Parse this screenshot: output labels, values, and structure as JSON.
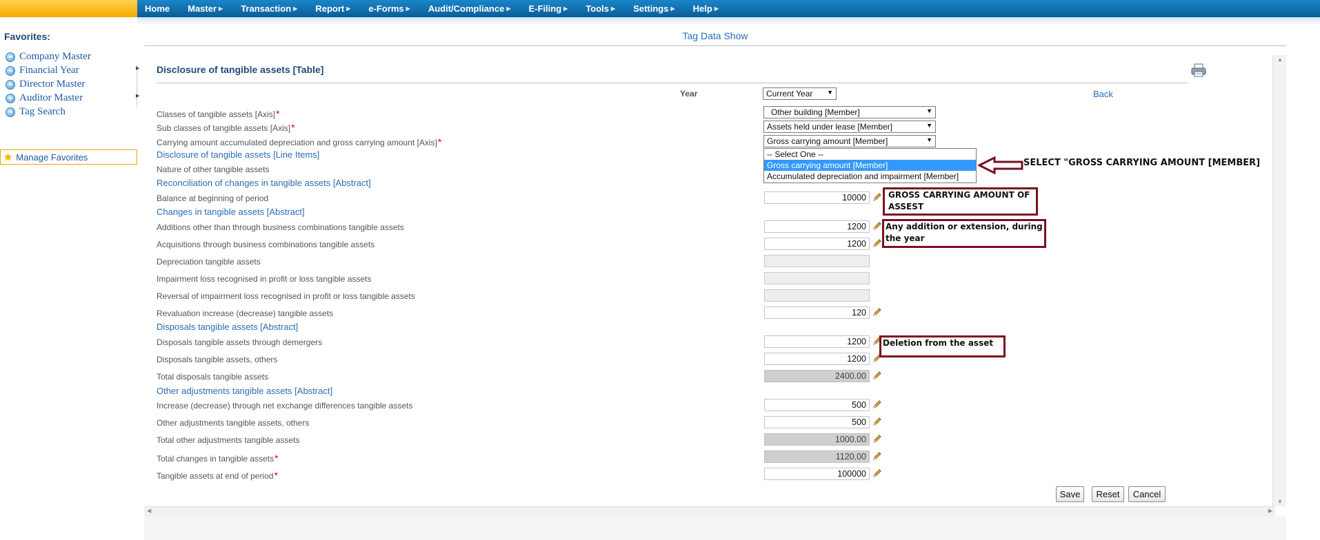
{
  "topmenu": [
    {
      "label": "Home",
      "has_sub": false
    },
    {
      "label": "Master",
      "has_sub": true
    },
    {
      "label": "Transaction",
      "has_sub": true
    },
    {
      "label": "Report",
      "has_sub": true
    },
    {
      "label": "e-Forms",
      "has_sub": true
    },
    {
      "label": "Audit/Compliance",
      "has_sub": true
    },
    {
      "label": "E-Filing",
      "has_sub": true
    },
    {
      "label": "Tools",
      "has_sub": true
    },
    {
      "label": "Settings",
      "has_sub": true
    },
    {
      "label": "Help",
      "has_sub": true
    }
  ],
  "sidebar": {
    "title": "Favorites:",
    "items": [
      "Company Master",
      "Financial Year",
      "Director Master",
      "Auditor Master",
      "Tag Search"
    ],
    "manage_label": "Manage Favorites"
  },
  "header": {
    "tag_data_show": "Tag Data Show"
  },
  "form": {
    "title": "Disclosure of tangible assets [Table]",
    "year_label": "Year",
    "year_value": "Current Year",
    "back_label": "Back",
    "axes": [
      {
        "label": "Classes of tangible assets [Axis]",
        "required": true,
        "value": "Other building [Member]"
      },
      {
        "label": "Sub classes of tangible assets [Axis]",
        "required": true,
        "value": "Assets held under lease [Member]"
      },
      {
        "label": "Carrying amount accumulated depreciation and gross carrying amount [Axis]",
        "required": true,
        "value": "Gross carrying amount [Member]"
      }
    ],
    "dropdown_options": [
      "-- Select One --",
      "Gross carrying amount [Member]",
      "Accumulated depreciation and impairment [Member]"
    ],
    "dropdown_selected_index": 1,
    "sections": {
      "line_items": "Disclosure of tangible assets [Line Items]",
      "reconciliation": "Reconciliation of changes in tangible assets [Abstract]",
      "changes": "Changes in tangible assets [Abstract]",
      "disposals": "Disposals tangible assets [Abstract]",
      "other_adjustments": "Other adjustments tangible assets [Abstract]"
    },
    "rows": {
      "nature": {
        "label": "Nature of other tangible assets"
      },
      "balance_begin": {
        "label": "Balance at beginning of period",
        "value": "10000"
      },
      "additions": {
        "label": "Additions other than through business combinations tangible assets",
        "value": "1200"
      },
      "acquisitions": {
        "label": "Acquisitions through business combinations tangible assets",
        "value": "1200"
      },
      "depreciation": {
        "label": "Depreciation tangible assets",
        "value": ""
      },
      "impairment": {
        "label": "Impairment loss recognised in profit or loss tangible assets",
        "value": ""
      },
      "reversal": {
        "label": "Reversal of impairment loss recognised in profit or loss tangible assets",
        "value": ""
      },
      "revaluation": {
        "label": "Revaluation increase (decrease) tangible assets",
        "value": "120"
      },
      "disposals_demergers": {
        "label": "Disposals tangible assets through demergers",
        "value": "1200"
      },
      "disposals_others": {
        "label": "Disposals tangible assets, others",
        "value": "1200"
      },
      "total_disposals": {
        "label": "Total disposals tangible assets",
        "value": "2400.00"
      },
      "exchange_diff": {
        "label": "Increase (decrease) through net exchange differences tangible assets",
        "value": "500"
      },
      "other_adj_others": {
        "label": "Other adjustments tangible assets, others",
        "value": "500"
      },
      "total_other_adj": {
        "label": "Total other adjustments tangible assets",
        "value": "1000.00"
      },
      "total_changes": {
        "label": "Total changes in tangible assets",
        "value": "1120.00",
        "required": true
      },
      "end_period": {
        "label": "Tangible assets at end of period",
        "value": "100000",
        "required": true
      }
    },
    "buttons": {
      "save": "Save",
      "reset": "Reset",
      "cancel": "Cancel"
    }
  },
  "annotations": {
    "select_note": "SELECT \"GROSS CARRYING AMOUNT [MEMBER]",
    "gross_note_line1": "GROSS CARRYING AMOUNT OF",
    "gross_note_line2": "ASSEST",
    "addition_note_line1": "Any addition or extension, during",
    "addition_note_line2": "the year",
    "deletion_note": "Deletion from the asset"
  }
}
